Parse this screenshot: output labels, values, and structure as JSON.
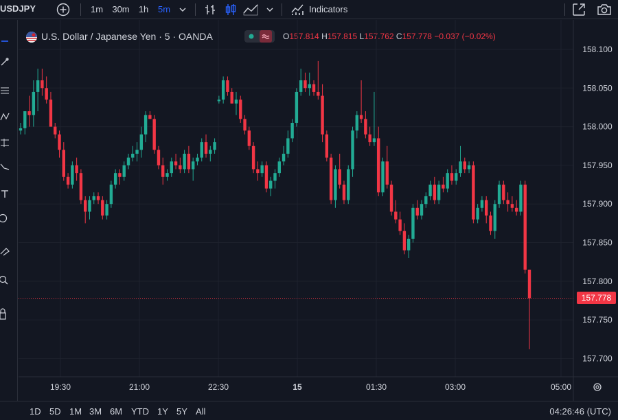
{
  "toolbar": {
    "symbol": "USDJPY",
    "intervals": [
      "1m",
      "30m",
      "1h",
      "5m"
    ],
    "active_interval": "5m",
    "indicators_label": "Indicators"
  },
  "legend": {
    "title": "U.S. Dollar / Japanese Yen · 5 · OANDA",
    "o_label": "O",
    "o_value": "157.814",
    "h_label": "H",
    "h_value": "157.815",
    "l_label": "L",
    "l_value": "157.762",
    "c_label": "C",
    "c_value": "157.778",
    "change": "−0.037 (−0.02%)"
  },
  "price_axis": {
    "ticks": [
      "158.100",
      "158.050",
      "158.000",
      "157.950",
      "157.900",
      "157.850",
      "157.800",
      "157.750",
      "157.700"
    ],
    "last_price": "157.778"
  },
  "time_axis": {
    "ticks": [
      "19:30",
      "21:00",
      "22:30",
      "15",
      "01:30",
      "03:00",
      "05:00"
    ]
  },
  "ranges": [
    "1D",
    "5D",
    "1M",
    "3M",
    "6M",
    "YTD",
    "1Y",
    "5Y",
    "All"
  ],
  "clock": "04:26:46 (UTC)",
  "colors": {
    "up": "#22ab94",
    "down": "#f23645",
    "bg": "#131722",
    "grid": "#1e222d",
    "accent": "#2962ff"
  },
  "icons": {
    "add": "plus-circle-icon",
    "bars": "bar-style-icon",
    "candles": "candle-style-icon",
    "area": "area-style-icon",
    "indicators": "indicators-icon",
    "fullscreen": "fullscreen-icon",
    "snapshot": "camera-icon",
    "settings": "gear-icon"
  },
  "chart_data": {
    "type": "candlestick",
    "y_range": [
      157.68,
      158.12
    ],
    "candles": [
      [
        157.995,
        158.005,
        157.99,
        157.998
      ],
      [
        157.998,
        158.02,
        157.99,
        158.02
      ],
      [
        158.02,
        158.04,
        158.0,
        158.015
      ],
      [
        158.015,
        158.06,
        158.0,
        158.045
      ],
      [
        158.045,
        158.075,
        158.02,
        158.06
      ],
      [
        158.06,
        158.075,
        158.04,
        158.05
      ],
      [
        158.05,
        158.065,
        158.03,
        158.035
      ],
      [
        158.035,
        158.045,
        158.0,
        158.0
      ],
      [
        158.0,
        158.005,
        157.985,
        157.99
      ],
      [
        157.99,
        157.995,
        157.96,
        157.97
      ],
      [
        157.97,
        157.98,
        157.93,
        157.935
      ],
      [
        157.935,
        157.94,
        157.92,
        157.925
      ],
      [
        157.925,
        157.955,
        157.92,
        157.95
      ],
      [
        157.95,
        157.96,
        157.93,
        157.94
      ],
      [
        157.94,
        157.945,
        157.9,
        157.905
      ],
      [
        157.905,
        157.91,
        157.875,
        157.89
      ],
      [
        157.89,
        157.91,
        157.88,
        157.905
      ],
      [
        157.905,
        157.915,
        157.9,
        157.91
      ],
      [
        157.91,
        157.915,
        157.9,
        157.905
      ],
      [
        157.905,
        157.91,
        157.88,
        157.885
      ],
      [
        157.885,
        157.905,
        157.88,
        157.9
      ],
      [
        157.9,
        157.93,
        157.895,
        157.925
      ],
      [
        157.925,
        157.945,
        157.92,
        157.94
      ],
      [
        157.94,
        157.945,
        157.925,
        157.935
      ],
      [
        157.935,
        157.955,
        157.93,
        157.95
      ],
      [
        157.95,
        157.965,
        157.945,
        157.96
      ],
      [
        157.96,
        157.975,
        157.955,
        157.965
      ],
      [
        157.965,
        157.98,
        157.955,
        157.97
      ],
      [
        157.97,
        158.0,
        157.96,
        157.99
      ],
      [
        157.99,
        158.02,
        157.98,
        158.015
      ],
      [
        158.015,
        158.02,
        158.01,
        158.01
      ],
      [
        158.01,
        158.015,
        157.965,
        157.97
      ],
      [
        157.97,
        157.975,
        157.945,
        157.95
      ],
      [
        157.95,
        157.96,
        157.925,
        157.935
      ],
      [
        157.935,
        157.945,
        157.93,
        157.94
      ],
      [
        157.94,
        157.96,
        157.935,
        157.955
      ],
      [
        157.955,
        157.965,
        157.945,
        157.95
      ],
      [
        157.95,
        157.96,
        157.94,
        157.945
      ],
      [
        157.945,
        157.97,
        157.94,
        157.965
      ],
      [
        157.965,
        157.975,
        157.94,
        157.945
      ],
      [
        157.945,
        157.96,
        157.93,
        157.955
      ],
      [
        157.955,
        157.965,
        157.95,
        157.96
      ],
      [
        157.96,
        157.985,
        157.955,
        157.98
      ],
      [
        157.98,
        157.99,
        157.96,
        157.965
      ],
      [
        157.965,
        157.975,
        157.955,
        157.97
      ],
      [
        157.97,
        157.985,
        157.965,
        157.98
      ],
      [
        158.033,
        158.04,
        158.03,
        158.035
      ],
      [
        158.035,
        158.065,
        158.03,
        158.06
      ],
      [
        158.06,
        158.065,
        158.04,
        158.045
      ],
      [
        158.045,
        158.05,
        158.03,
        158.03
      ],
      [
        158.03,
        158.045,
        158.015,
        158.035
      ],
      [
        158.035,
        158.04,
        158.005,
        158.01
      ],
      [
        158.01,
        158.015,
        157.99,
        157.995
      ],
      [
        157.995,
        158.0,
        157.97,
        157.975
      ],
      [
        157.975,
        157.98,
        157.94,
        157.945
      ],
      [
        157.945,
        157.955,
        157.93,
        157.94
      ],
      [
        157.94,
        157.955,
        157.935,
        157.95
      ],
      [
        157.95,
        157.955,
        157.915,
        157.92
      ],
      [
        157.92,
        157.935,
        157.91,
        157.93
      ],
      [
        157.93,
        157.945,
        157.92,
        157.94
      ],
      [
        157.94,
        157.96,
        157.935,
        157.955
      ],
      [
        157.955,
        157.975,
        157.95,
        157.965
      ],
      [
        157.965,
        157.995,
        157.96,
        157.985
      ],
      [
        157.985,
        158.01,
        157.98,
        158.005
      ],
      [
        158.005,
        158.05,
        158.0,
        158.045
      ],
      [
        158.045,
        158.075,
        158.04,
        158.06
      ],
      [
        158.06,
        158.07,
        158.045,
        158.05
      ],
      [
        158.05,
        158.07,
        158.04,
        158.055
      ],
      [
        158.055,
        158.06,
        158.04,
        158.045
      ],
      [
        158.045,
        158.085,
        158.035,
        158.04
      ],
      [
        158.04,
        158.055,
        157.98,
        157.99
      ],
      [
        157.99,
        157.995,
        157.955,
        157.96
      ],
      [
        157.96,
        157.965,
        157.9,
        157.905
      ],
      [
        157.905,
        157.95,
        157.895,
        157.945
      ],
      [
        157.945,
        157.965,
        157.92,
        157.925
      ],
      [
        157.925,
        157.93,
        157.9,
        157.905
      ],
      [
        157.905,
        157.95,
        157.9,
        157.945
      ],
      [
        157.945,
        158.0,
        157.935,
        157.995
      ],
      [
        157.995,
        158.02,
        157.985,
        158.015
      ],
      [
        158.015,
        158.06,
        158.005,
        158.01
      ],
      [
        158.01,
        158.02,
        157.985,
        157.99
      ],
      [
        157.99,
        158.0,
        157.975,
        157.98
      ],
      [
        157.98,
        158.045,
        157.975,
        157.985
      ],
      [
        157.985,
        158.0,
        157.91,
        157.915
      ],
      [
        157.915,
        157.96,
        157.91,
        157.955
      ],
      [
        157.955,
        157.975,
        157.92,
        157.925
      ],
      [
        157.925,
        157.93,
        157.885,
        157.89
      ],
      [
        157.89,
        157.905,
        157.875,
        157.88
      ],
      [
        157.88,
        157.89,
        157.86,
        157.865
      ],
      [
        157.865,
        157.875,
        157.835,
        157.84
      ],
      [
        157.84,
        157.86,
        157.83,
        157.855
      ],
      [
        157.855,
        157.9,
        157.85,
        157.895
      ],
      [
        157.895,
        157.905,
        157.88,
        157.885
      ],
      [
        157.885,
        157.905,
        157.88,
        157.9
      ],
      [
        157.9,
        157.915,
        157.895,
        157.91
      ],
      [
        157.91,
        157.93,
        157.905,
        157.925
      ],
      [
        157.925,
        157.935,
        157.9,
        157.905
      ],
      [
        157.905,
        157.93,
        157.9,
        157.925
      ],
      [
        157.925,
        157.935,
        157.915,
        157.92
      ],
      [
        157.92,
        157.945,
        157.915,
        157.94
      ],
      [
        157.94,
        157.95,
        157.925,
        157.93
      ],
      [
        157.93,
        157.945,
        157.925,
        157.94
      ],
      [
        157.94,
        157.975,
        157.935,
        157.955
      ],
      [
        157.955,
        157.96,
        157.94,
        157.945
      ],
      [
        157.945,
        157.955,
        157.94,
        157.95
      ],
      [
        157.95,
        157.955,
        157.875,
        157.88
      ],
      [
        157.88,
        157.9,
        157.875,
        157.895
      ],
      [
        157.895,
        157.91,
        157.89,
        157.905
      ],
      [
        157.905,
        157.91,
        157.875,
        157.885
      ],
      [
        157.885,
        157.89,
        157.86,
        157.865
      ],
      [
        157.865,
        157.905,
        157.855,
        157.9
      ],
      [
        157.9,
        157.93,
        157.895,
        157.925
      ],
      [
        157.925,
        157.93,
        157.9,
        157.905
      ],
      [
        157.905,
        157.915,
        157.89,
        157.9
      ],
      [
        157.9,
        157.91,
        157.89,
        157.895
      ],
      [
        157.895,
        157.905,
        157.885,
        157.89
      ],
      [
        157.89,
        157.93,
        157.885,
        157.925
      ],
      [
        157.925,
        157.93,
        157.81,
        157.815
      ],
      [
        157.815,
        157.815,
        157.712,
        157.778
      ]
    ]
  }
}
